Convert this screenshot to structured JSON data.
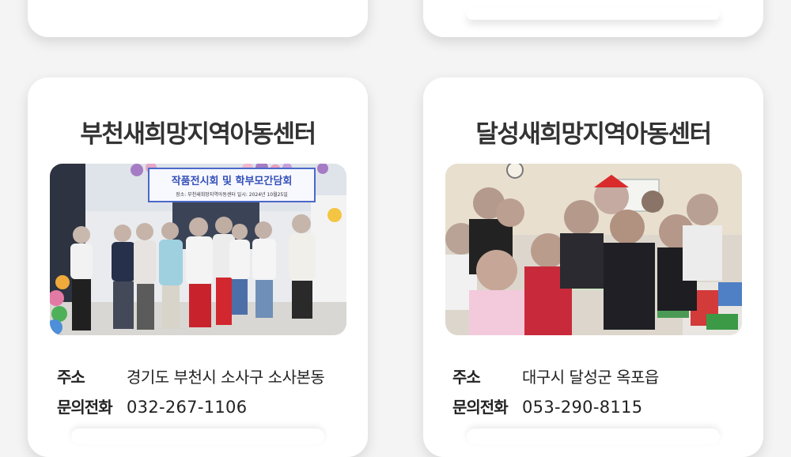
{
  "centers": [
    {
      "name": "부천새희망지역아동센터",
      "banner_text": "작품전시회 및 학부모간담회",
      "banner_subtext": "장소: 부천새희망지역아동센터    일시: 2024년 10월25일",
      "address_label": "주소",
      "address": "경기도 부천시 소사구 소사본동",
      "phone_label": "문의전화",
      "phone": "032-267-1106"
    },
    {
      "name": "달성새희망지역아동센터",
      "address_label": "주소",
      "address": "대구시 달성군 옥포읍",
      "phone_label": "문의전화",
      "phone": "053-290-8115"
    }
  ],
  "colors": {
    "page_bg": "#f4f4f4",
    "card_bg": "#ffffff",
    "title": "#333333",
    "text": "#222222"
  }
}
